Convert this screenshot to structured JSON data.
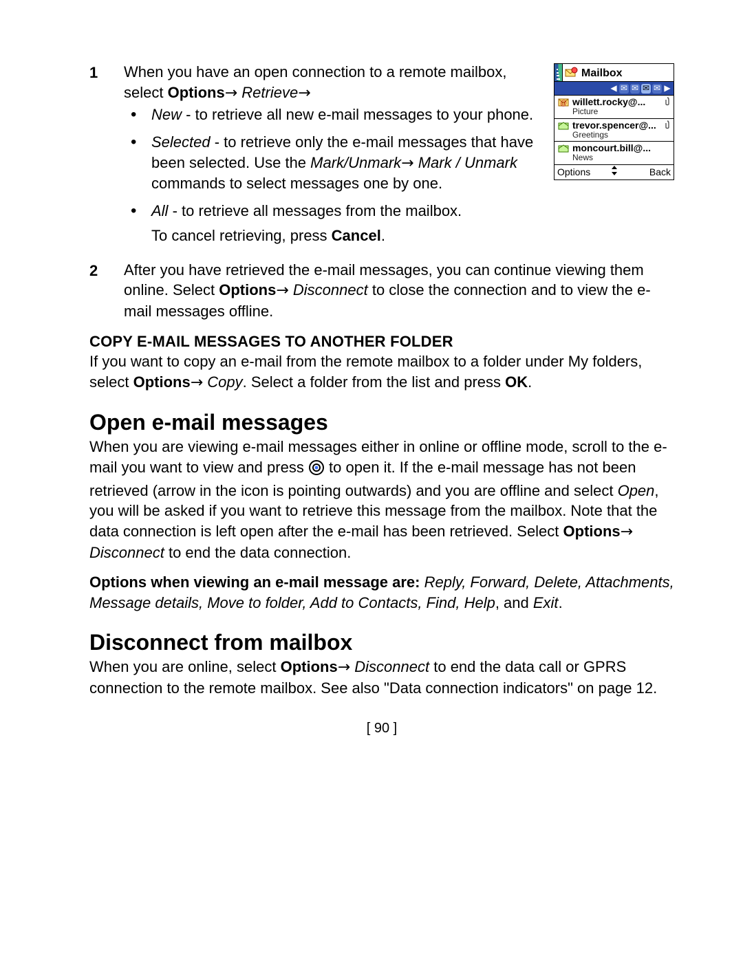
{
  "steps": {
    "s1": {
      "intro1": "When you have an open connection to a remote mailbox, select ",
      "intro_opt": "Options",
      "intro_ret": "Retrieve",
      "b_new_label": "New",
      "b_new_text": " - to retrieve all new e-mail messages to your phone.",
      "b_sel_label": "Selected",
      "b_sel_text_a": " - to retrieve only the e-mail messages that have been selected. Use the ",
      "b_sel_mark": "Mark/Unmark",
      "b_sel_text_b": " ",
      "b_sel_markunmark": "Mark / Unmark",
      "b_sel_text_c": " commands to select messages one by one.",
      "b_all_label": "All",
      "b_all_text": " - to retrieve all messages from the mailbox.",
      "cancel_a": "To cancel retrieving, press ",
      "cancel_b": "Cancel",
      "cancel_c": "."
    },
    "s2": {
      "text_a": "After you have retrieved the e-mail messages, you can continue viewing them online. Select ",
      "opt": "Options",
      "disc": "Disconnect",
      "text_b": " to close the connection and to view the e-mail messages offline."
    }
  },
  "copy": {
    "heading": "COPY E-MAIL MESSAGES TO ANOTHER FOLDER",
    "a": "If you want to copy an e-mail from the remote mailbox to a folder under My folders, select ",
    "opt": "Options",
    "copy": "Copy",
    "b": ". Select a folder from the list and press ",
    "ok": "OK",
    "c": "."
  },
  "open": {
    "heading": "Open e-mail messages",
    "p1a": "When you are viewing e-mail messages either in online or offline mode, scroll to the e-mail you want to view and press ",
    "p1b": " to open it. If the e-mail message has not been retrieved (arrow in the icon is pointing outwards) and you are offline and select ",
    "open_word": "Open",
    "p1c": ", you will be asked if you want to retrieve this message from the mailbox. Note that the data connection is left open after the e-mail has been retrieved. Select ",
    "opt": "Options",
    "disc": "Disconnect",
    "p1d": " to end the data connection.",
    "opts_lead": "Options when viewing an e-mail message are: ",
    "opts_list": "Reply, Forward, Delete, Attachments, Message details, Move to folder, Add to Contacts, Find, Help",
    "opts_tail_a": ", and ",
    "opts_tail_b": "Exit",
    "opts_tail_c": "."
  },
  "disconnect": {
    "heading": "Disconnect from mailbox",
    "a": "When you are online, select ",
    "opt": "Options",
    "disc": "Disconnect",
    "b": " to end the data call or GPRS connection to the remote mailbox. See also \"Data connection indicators\" on page 12."
  },
  "page_number": "[ 90 ]",
  "arrow": "→",
  "phone": {
    "title": "Mailbox",
    "items": [
      {
        "from": "willett.rocky@...",
        "subject": "Picture",
        "attachment": true,
        "unread": true
      },
      {
        "from": "trevor.spencer@...",
        "subject": "Greetings",
        "attachment": true,
        "unread": false
      },
      {
        "from": "moncourt.bill@...",
        "subject": "News",
        "attachment": false,
        "unread": false
      }
    ],
    "soft_left": "Options",
    "soft_right": "Back"
  }
}
